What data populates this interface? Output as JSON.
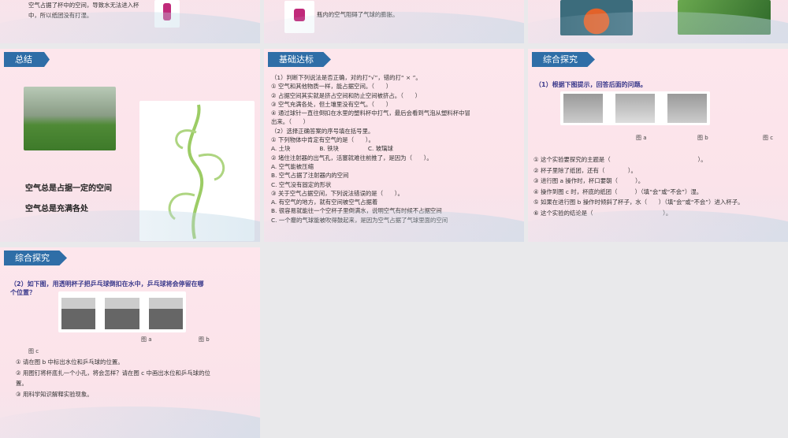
{
  "top_slides": {
    "left_text": [
      "空气占据了杯中的空间，导致水无法进入杯",
      "中，所以纸团没有打湿。"
    ],
    "middle_text": "瓶内的空气阻碍了气球的膨胀。"
  },
  "summary": {
    "tag": "总结",
    "lines": [
      "空气总是占据一定的空间",
      "空气总是充满各处"
    ]
  },
  "basic": {
    "tag": "基础达标",
    "lines": [
      "（1）判断下列说法是否正确，对的打“√”，错的打“ × ”。",
      "① 空气和其他物质一样，能占据空间。（　　）",
      "② 占据空间其实就是挤占空间和防止空间被挤占。（　　）",
      "③ 空气充满各处，但土壤里没有空气。（　　）",
      "④ 通过球针一直往倒扣在水里的塑料杯中打气，最后会看到气泡从塑料杯中冒",
      "出来。（　　）",
      "（2）选择正确答案的序号填在括号里。",
      "① 下列物体中肯定有空气的是（　　）。",
      "A. 土块　　　　　B. 铁块　　　　　C. 玻璃球",
      "② 堵住注射器的出气孔，活塞就难往前推了，是因为（　　）。",
      "A. 空气能被压缩",
      "B. 空气占据了注射器内的空间",
      "C. 空气没有固定的形状",
      "③ 关于空气占据空间，下列说法错误的是（　　）。",
      "A. 有空气的地方，就有空间被空气占据着",
      "B. 很容易就能往一个空杯子里倒满水，说明空气有时候不占据空间",
      "C. 一个瘪的气球能被吹得鼓起来，是因为空气占据了气球里面的空间"
    ]
  },
  "explore1": {
    "tag": "综合探究",
    "title": "（1）根据下图提示，回答后面的问题。",
    "captions": [
      "图 a",
      "图 b",
      "图 c"
    ],
    "lines": [
      "① 这个实验要探究的主题是（　　　　　　　　　　　　　　　）。",
      "② 杯子里除了纸团，还有（　　　　）。",
      "③ 进行图 a 操作时，杯口要朝（　　　）。",
      "④ 操作到图 c 时，杯底的纸团（　　　）（填“会”或“不会”）湿。",
      "⑤ 如果在进行图 b 操作时倾斜了杯子，水（　　）（填“会”或“不会”）进入杯子。",
      "⑥ 这个实验的结论是（　　　　　　　　　　　　）。"
    ]
  },
  "explore2": {
    "tag": "综合探究",
    "title": [
      "（2）如下图，用透明杯子把乒乓球倒扣在水中，乒乓球将会停留在哪",
      "个位置？"
    ],
    "captions": [
      "图 a",
      "图 b",
      "图 c"
    ],
    "lines": [
      "① 请在图 b 中标出水位和乒乓球的位置。",
      "② 用图钉将杯底扎一个小孔，将会怎样？请在图 c 中画出水位和乒乓球的位",
      "置。",
      "③ 用科学知识解释实验现象。"
    ]
  }
}
